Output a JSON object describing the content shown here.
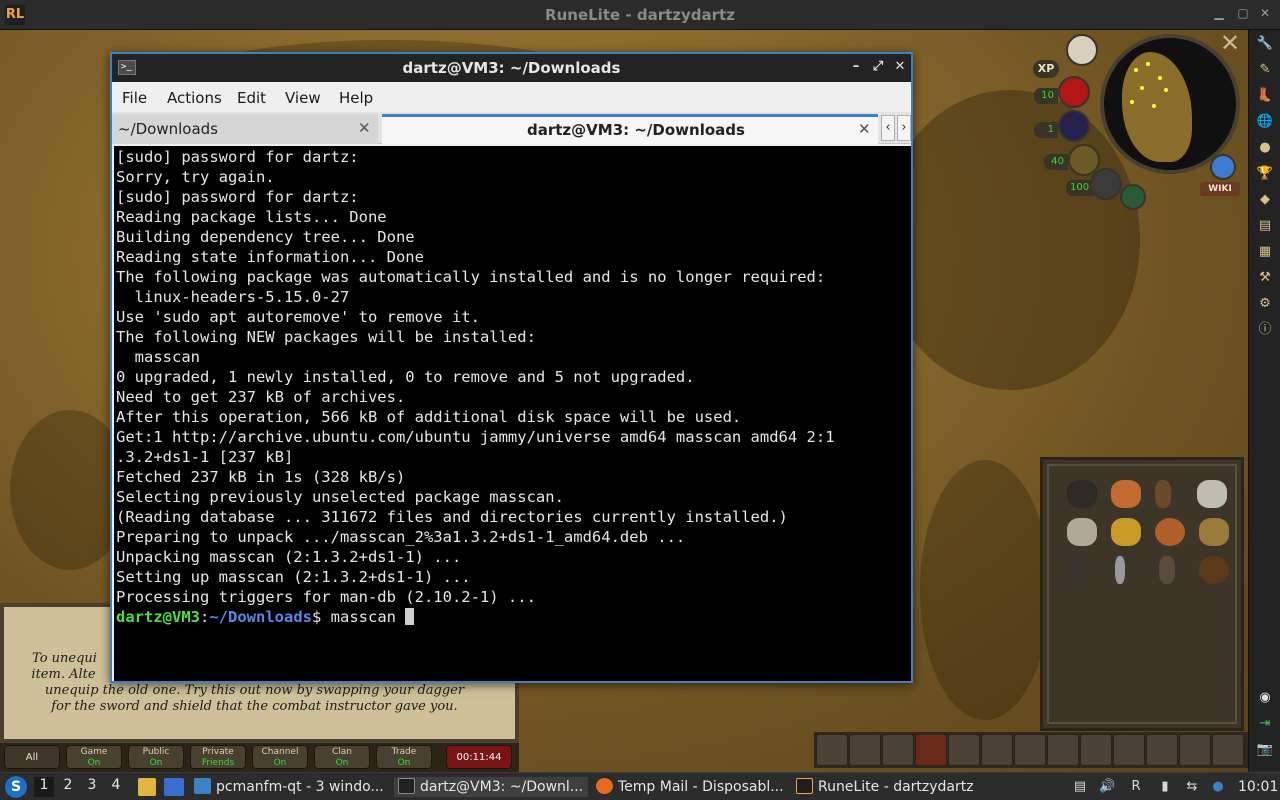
{
  "runelite": {
    "title": "RuneLite - dartzydartz",
    "logo": "RL"
  },
  "terminal": {
    "title": "dartz@VM3: ~/Downloads",
    "menu": [
      "File",
      "Actions",
      "Edit",
      "View",
      "Help"
    ],
    "tabs": [
      {
        "label": "~/Downloads",
        "active": false
      },
      {
        "label": "dartz@VM3: ~/Downloads",
        "active": true
      }
    ],
    "lines": [
      "[sudo] password for dartz:",
      "Sorry, try again.",
      "[sudo] password for dartz:",
      "Reading package lists... Done",
      "Building dependency tree... Done",
      "Reading state information... Done",
      "The following package was automatically installed and is no longer required:",
      "  linux-headers-5.15.0-27",
      "Use 'sudo apt autoremove' to remove it.",
      "The following NEW packages will be installed:",
      "  masscan",
      "0 upgraded, 1 newly installed, 0 to remove and 5 not upgraded.",
      "Need to get 237 kB of archives.",
      "After this operation, 566 kB of additional disk space will be used.",
      "Get:1 http://archive.ubuntu.com/ubuntu jammy/universe amd64 masscan amd64 2:1",
      ".3.2+ds1-1 [237 kB]",
      "Fetched 237 kB in 1s (328 kB/s)",
      "Selecting previously unselected package masscan.",
      "(Reading database ... 311672 files and directories currently installed.)",
      "Preparing to unpack .../masscan_2%3a1.3.2+ds1-1_amd64.deb ...",
      "Unpacking masscan (2:1.3.2+ds1-1) ...",
      "Setting up masscan (2:1.3.2+ds1-1) ...",
      "Processing triggers for man-db (2.10.2-1) ..."
    ],
    "prompt": {
      "user": "dartz@VM3",
      "sep": ":",
      "path": "~/Downloads",
      "symbol": "$ ",
      "command": "masscan "
    }
  },
  "game": {
    "chat_lines": [
      "To unequi",
      "item. Alte",
      "unequip the old one. Try this out now by swapping your dagger",
      "for the sword and shield that the combat instructor gave you."
    ],
    "chat_buttons": [
      {
        "label": "All",
        "state": ""
      },
      {
        "label": "Game",
        "state": "On"
      },
      {
        "label": "Public",
        "state": "On"
      },
      {
        "label": "Private",
        "state": "Friends"
      },
      {
        "label": "Channel",
        "state": "On"
      },
      {
        "label": "Clan",
        "state": "On"
      },
      {
        "label": "Trade",
        "state": "On"
      }
    ],
    "timer": "00:11:44",
    "orbs": {
      "xp_label": "XP",
      "hitpoints": "10",
      "prayer": "1",
      "run": "40",
      "special": "100"
    },
    "wiki_label": "WIKI"
  },
  "taskbar": {
    "workspaces": [
      "1",
      "2",
      "3",
      "4"
    ],
    "tasks": [
      {
        "label": "pcmanfm-qt - 3 windo...",
        "icon": "folder-icon"
      },
      {
        "label": "dartz@VM3: ~/Downl...",
        "icon": "terminal-icon"
      },
      {
        "label": "Temp Mail - Disposabl...",
        "icon": "firefox-icon"
      },
      {
        "label": "RuneLite - dartzydartz",
        "icon": "runelite-icon"
      }
    ],
    "clock": "10:01"
  },
  "colors": {
    "terminal_border": "#3b82c4",
    "prompt_user": "#4ae043",
    "prompt_path": "#5a86e8",
    "timer_bg": "#7a1414"
  }
}
